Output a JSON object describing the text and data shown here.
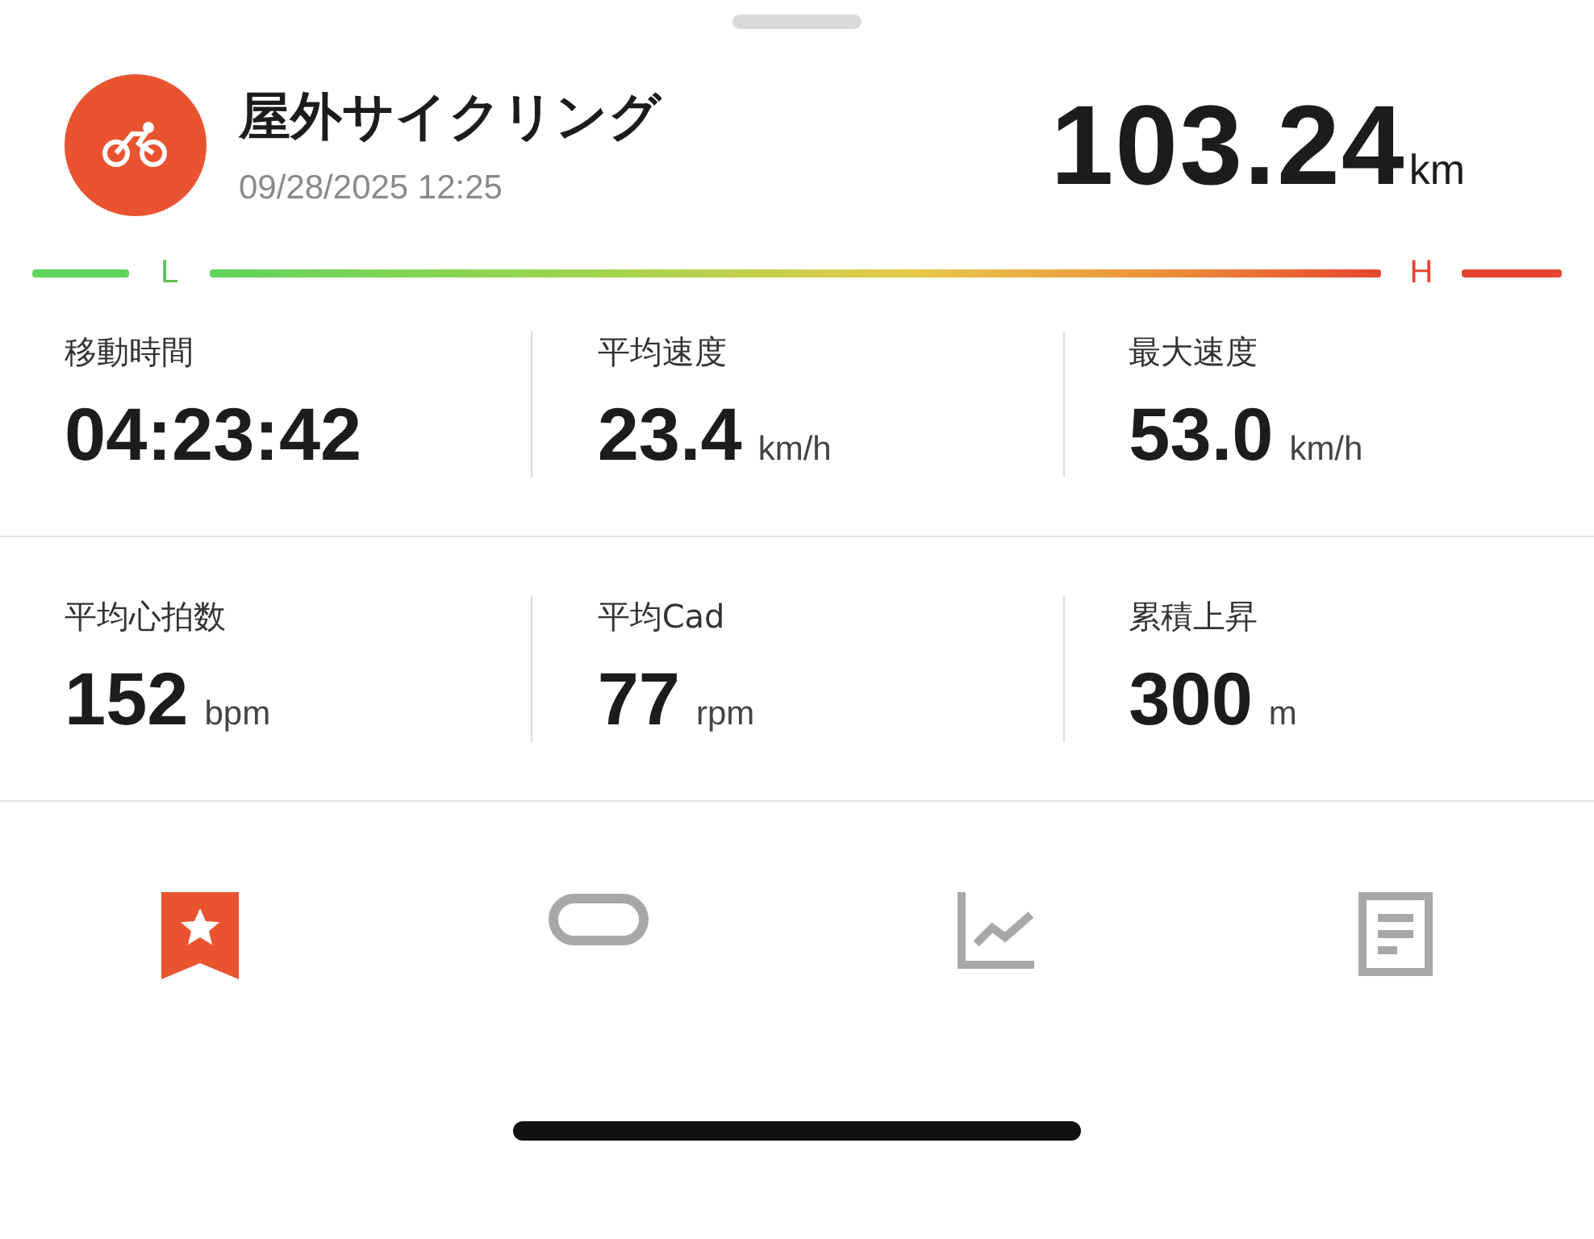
{
  "activity": {
    "title": "屋外サイクリング",
    "date": "09/28/2025 12:25",
    "distance": "103.24",
    "distance_unit": "km"
  },
  "intensity": {
    "low_label": "L",
    "high_label": "H"
  },
  "stats": [
    [
      {
        "label": "移動時間",
        "value": "04:23:42"
      },
      {
        "label": "平均速度",
        "value": "23.4",
        "unit": "km/h"
      },
      {
        "label": "最大速度",
        "value": "53.0",
        "unit": "km/h"
      }
    ],
    [
      {
        "label": "平均心拍数",
        "value": "152",
        "unit": "bpm"
      },
      {
        "label": "平均Cad",
        "value": "77",
        "unit": "rpm"
      },
      {
        "label": "累積上昇",
        "value": "300",
        "unit": "m"
      }
    ]
  ],
  "tabs": [
    {
      "kind": "bookmark",
      "selected": true
    },
    {
      "kind": "link",
      "selected": false
    },
    {
      "kind": "chart",
      "selected": false
    },
    {
      "kind": "document",
      "selected": false
    }
  ]
}
